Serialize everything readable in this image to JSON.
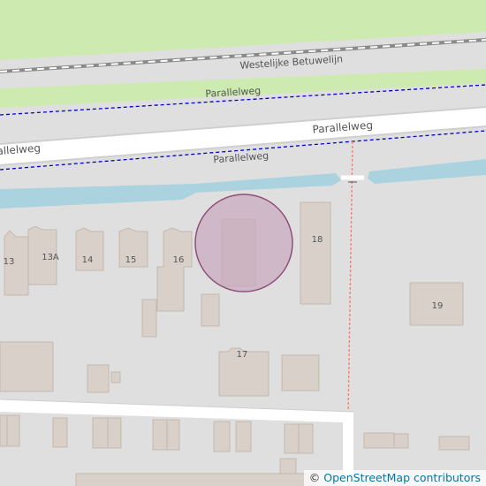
{
  "map": {
    "railway_label": "Westelijke Betuwelijn",
    "road_labels": {
      "upper_service_road": "Parallelweg",
      "main_road_left": "Parallelweg",
      "main_road_right": "Parallelweg",
      "lower_service_road": "Parallelweg"
    },
    "house_numbers": {
      "n13": "13",
      "n13a": "13A",
      "n14": "14",
      "n15": "15",
      "n16": "16",
      "n17": "17",
      "n18": "18",
      "n19": "19"
    },
    "colors": {
      "background": "#e0dfdf",
      "grass": "#cdebb0",
      "water": "#aad3df",
      "building": "#d9d0c9",
      "building_outline": "#c5b9ae",
      "road": "#ffffff",
      "road_casing": "#cfcfcf",
      "rail": "#777777",
      "cycleway": "#0000ff",
      "footway": "#fa8072",
      "marker_fill": "#c8a8bd",
      "marker_stroke": "#8e4f7a"
    }
  },
  "attribution": {
    "symbol": "©",
    "text": "OpenStreetMap contributors"
  }
}
